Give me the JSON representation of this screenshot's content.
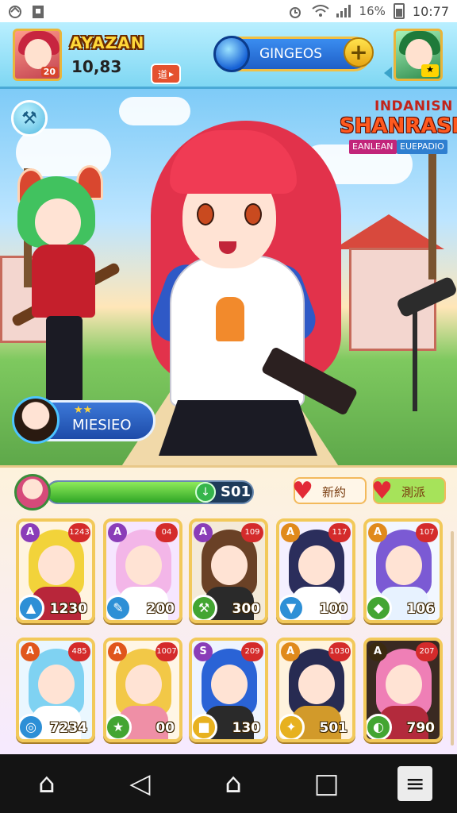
{
  "status_bar": {
    "battery_text": "16%",
    "time": "10:77",
    "icons": [
      "settings-icon",
      "sim-icon",
      "alarm-icon",
      "wifi-icon",
      "signal-icon",
      "battery-icon"
    ]
  },
  "header": {
    "player_name": "AYAZAN",
    "player_level": "20",
    "player_coins": "10,83",
    "badge_label": "道",
    "badge_arrow": "▸",
    "currency_label": "GINGEOS",
    "currency_plus": "+",
    "friend_badge": "★"
  },
  "scene": {
    "settings_glyph": "⚒",
    "event_title_line1": "INDANISN",
    "event_title_line2": "SHANRASI",
    "event_tag_left": "EANLEAN",
    "event_tag_right": "EUEPADIO",
    "mission_stars": "★★",
    "mission_label": "MIESIEO"
  },
  "panel": {
    "xp_value": "S01",
    "xp_icon": "↓",
    "xp_progress": 0.82,
    "heart_buttons": [
      {
        "glyph": "♥",
        "label": "新約"
      },
      {
        "glyph": "♥",
        "label": "測派"
      }
    ],
    "cards": [
      {
        "rank": "A",
        "level": "1243",
        "power": "1230",
        "role_glyph": "▲",
        "hair": "#f2d33a",
        "outfit": "#b8263a",
        "bg": "#fff4e0",
        "rank_color": "#8a3db8",
        "role_color": "#2d8fd6"
      },
      {
        "rank": "A",
        "level": "04",
        "power": "200",
        "role_glyph": "✎",
        "hair": "#f3b6e8",
        "outfit": "#ffffff",
        "bg": "#f6e6ff",
        "rank_color": "#8a3db8",
        "role_color": "#2d8fd6"
      },
      {
        "rank": "A",
        "level": "109",
        "power": "300",
        "role_glyph": "⚒",
        "hair": "#6a4126",
        "outfit": "#2a2a2a",
        "bg": "#f4ead8",
        "rank_color": "#8a3db8",
        "role_color": "#43a532"
      },
      {
        "rank": "A",
        "level": "117",
        "power": "100",
        "role_glyph": "▼",
        "hair": "#2b2e5c",
        "outfit": "#ffffff",
        "bg": "#f4f0ff",
        "rank_color": "#e08a1c",
        "role_color": "#2d8fd6"
      },
      {
        "rank": "A",
        "level": "107",
        "power": "106",
        "role_glyph": "◆",
        "hair": "#7b5ad4",
        "outfit": "#e7f2ff",
        "bg": "#f2f7ff",
        "rank_color": "#e08a1c",
        "role_color": "#43a532"
      },
      {
        "rank": "A",
        "level": "485",
        "power": "7234",
        "role_glyph": "◎",
        "hair": "#7fd2f2",
        "outfit": "#ffffff",
        "bg": "#eaf7ff",
        "rank_color": "#e0561c",
        "role_color": "#2d8fd6"
      },
      {
        "rank": "A",
        "level": "1007",
        "power": "00",
        "role_glyph": "★",
        "hair": "#f2c847",
        "outfit": "#ef8fa6",
        "bg": "#fff6e6",
        "rank_color": "#e0561c",
        "role_color": "#43a532"
      },
      {
        "rank": "S",
        "level": "209",
        "power": "130",
        "role_glyph": "■",
        "hair": "#2a63d6",
        "outfit": "#2a2a2a",
        "bg": "#eef4ff",
        "rank_color": "#8a3db8",
        "role_color": "#e7b11f"
      },
      {
        "rank": "A",
        "level": "1030",
        "power": "501",
        "role_glyph": "✦",
        "hair": "#272b52",
        "outfit": "#d29a2a",
        "bg": "#fff3dd",
        "rank_color": "#e08a1c",
        "role_color": "#e7b11f"
      },
      {
        "rank": "A",
        "level": "207",
        "power": "790",
        "role_glyph": "◐",
        "hair": "#ef7fb6",
        "outfit": "#b32a3c",
        "bg": "#3a2a22",
        "rank_color": "#3b2a10",
        "role_color": "#43a532"
      }
    ]
  },
  "nav": {
    "home_glyph": "⌂",
    "back_glyph": "◁",
    "home2_glyph": "⌂",
    "recents_glyph": "□",
    "menu_glyph": "≡"
  },
  "colors": {
    "header_top": "#b9efff",
    "accent_gold": "#f2c95a",
    "xp_green": "#2fa626",
    "hair_main": "#e2324b"
  }
}
